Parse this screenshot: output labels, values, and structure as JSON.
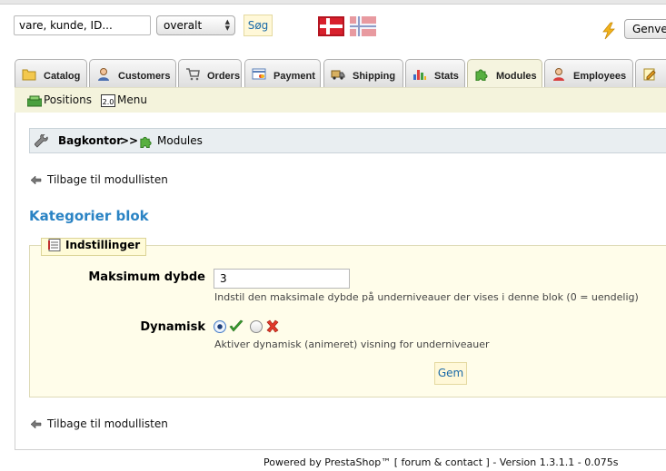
{
  "header": {
    "search_value": "vare, kunde, ID...",
    "search_scope": "overalt",
    "search_button": "Søg",
    "languages": [
      "Dansk",
      "Norsk"
    ],
    "shortcut_select": "Genve"
  },
  "tabs": [
    {
      "label": "Catalog",
      "icon": "folder-icon"
    },
    {
      "label": "Customers",
      "icon": "customers-icon"
    },
    {
      "label": "Orders",
      "icon": "cart-icon"
    },
    {
      "label": "Payment",
      "icon": "payment-icon"
    },
    {
      "label": "Shipping",
      "icon": "truck-icon"
    },
    {
      "label": "Stats",
      "icon": "stats-icon"
    },
    {
      "label": "Modules",
      "icon": "puzzle-icon",
      "active": true
    },
    {
      "label": "Employees",
      "icon": "employee-icon"
    },
    {
      "label": "",
      "icon": "preferences-icon"
    }
  ],
  "subnav": [
    {
      "label": "Positions",
      "icon": "positions-icon"
    },
    {
      "label": "Menu",
      "icon": "menu-icon"
    }
  ],
  "breadcrumb": {
    "root": "Bagkontor",
    "separator": ">>",
    "current": "Modules"
  },
  "back_link": "Tilbage til modullisten",
  "module_title": "Kategorier blok",
  "fieldset": {
    "legend": "Indstillinger",
    "max_depth": {
      "label": "Maksimum dybde",
      "value": "3",
      "hint": "Indstil den maksimale dybde på underniveauer der vises i denne blok (0 = uendelig)"
    },
    "dynamic": {
      "label": "Dynamisk",
      "selected": "yes",
      "hint": "Aktiver dynamisk (animeret) visning for underniveauer"
    },
    "save_button": "Gem"
  },
  "footer": {
    "powered": "Powered by PrestaShop™",
    "open": "[",
    "link": "forum & contact",
    "close": "]",
    "version": "- Version 1.3.1.1 - 0.075s"
  },
  "colors": {
    "title_blue": "#2a83c4",
    "panel_yellow": "#fffdea",
    "breadcrumb_bg": "#e9eef1",
    "button_text": "#1a6aa8"
  }
}
